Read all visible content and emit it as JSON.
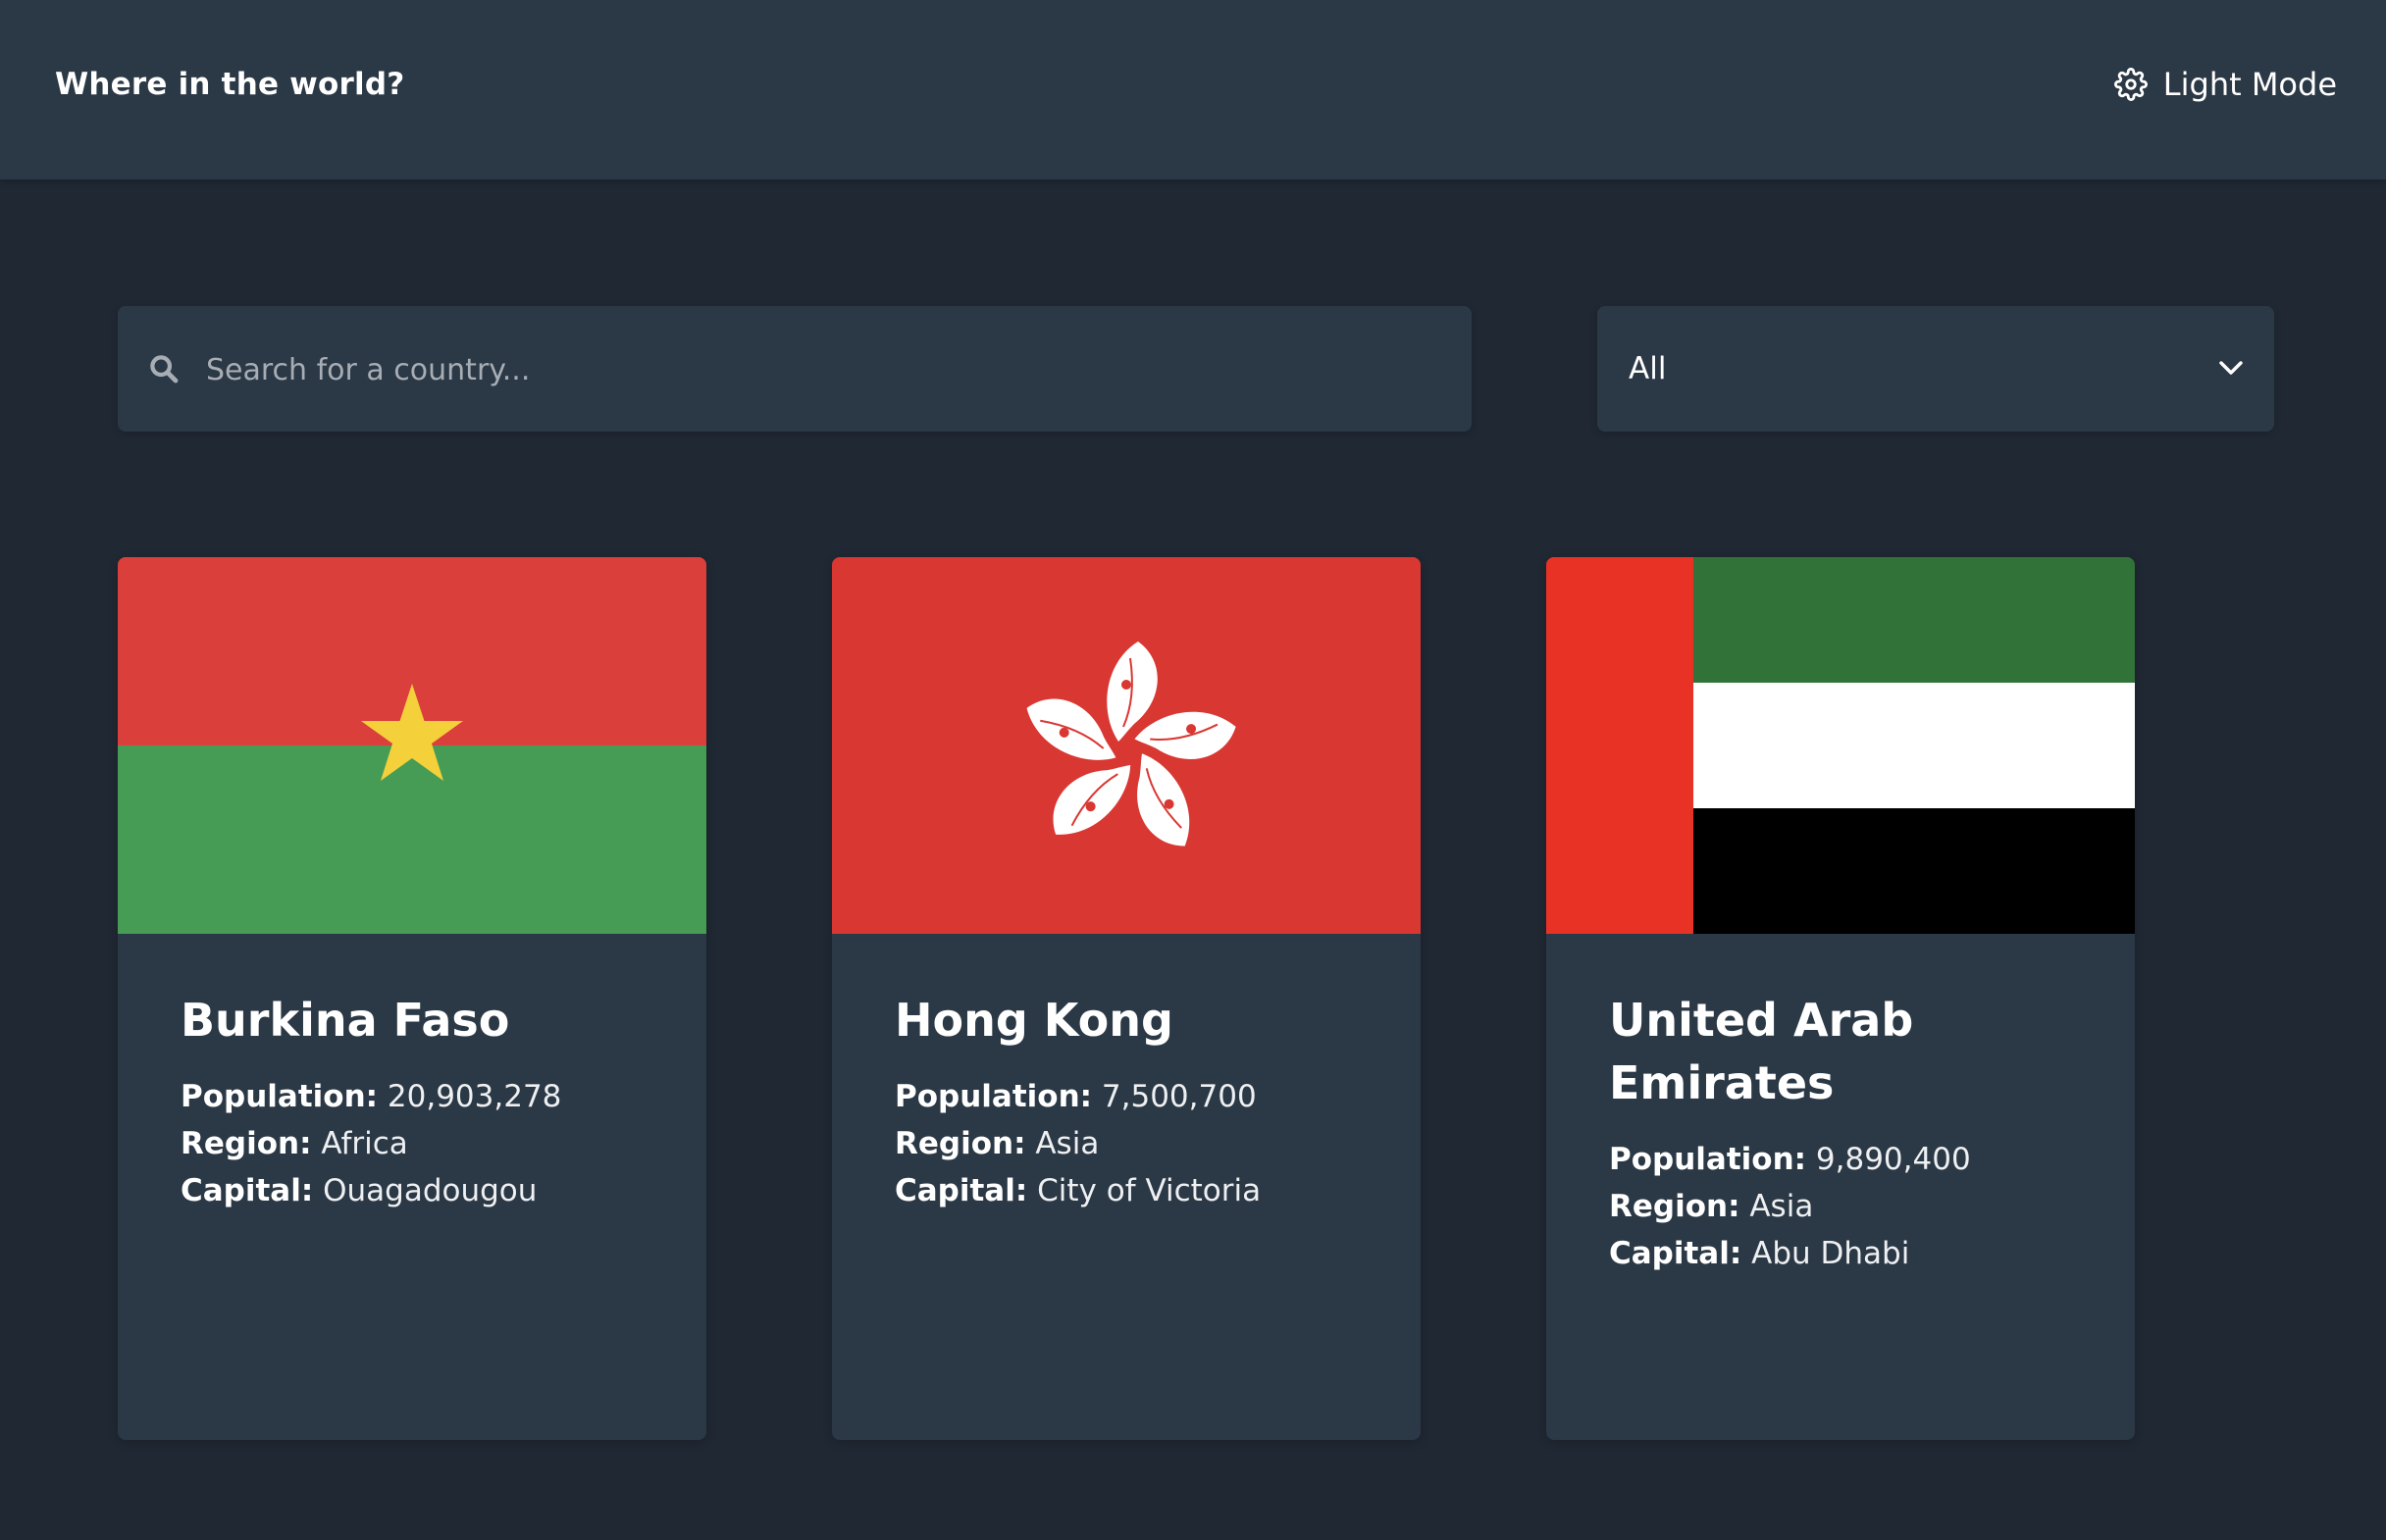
{
  "header": {
    "title": "Where in the world?",
    "theme_toggle_label": "Light Mode",
    "theme_icon": "gear-icon"
  },
  "search": {
    "placeholder": "Search for a country...",
    "value": "",
    "icon": "search-icon"
  },
  "filter": {
    "selected": "All",
    "icon": "chevron-down-icon"
  },
  "labels": {
    "population": "Population:",
    "region": "Region:",
    "capital": "Capital:"
  },
  "countries": [
    {
      "name": "Burkina Faso",
      "population": "20,903,278",
      "region": "Africa",
      "capital": "Ouagadougou"
    },
    {
      "name": "Hong Kong",
      "population": "7,500,700",
      "region": "Asia",
      "capital": "City of Victoria"
    },
    {
      "name": "United Arab Emirates",
      "population": "9,890,400",
      "region": "Asia",
      "capital": "Abu Dhabi"
    }
  ],
  "colors": {
    "background": "#202833",
    "surface": "#2b3845",
    "text": "#ffffff",
    "placeholder": "#a7adb4"
  }
}
